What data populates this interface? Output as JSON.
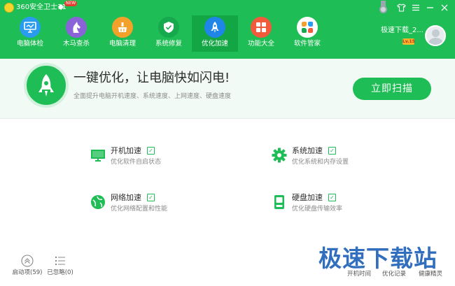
{
  "app": {
    "name": "360安全卫士11",
    "badge": "NEW"
  },
  "nav": [
    {
      "label": "电脑体检",
      "icon": "monitor-check-icon"
    },
    {
      "label": "木马查杀",
      "icon": "horse-icon"
    },
    {
      "label": "电脑清理",
      "icon": "broom-icon"
    },
    {
      "label": "系统修复",
      "icon": "shield-icon"
    },
    {
      "label": "优化加速",
      "icon": "rocket-icon",
      "active": true
    },
    {
      "label": "功能大全",
      "icon": "grid-icon"
    },
    {
      "label": "软件管家",
      "icon": "software-flower-icon"
    }
  ],
  "user": {
    "name": "极速下载_2...",
    "level": "Lv.15"
  },
  "banner": {
    "headline": "一键优化，让电脑快如闪电!",
    "subline": "全面提升电脑开机速度、系统速度、上网速度、硬盘速度",
    "scan_button": "立即扫描"
  },
  "features": [
    {
      "title": "开机加速",
      "desc": "优化软件自启状态",
      "checked": true
    },
    {
      "title": "系统加速",
      "desc": "优化系统和内存设置",
      "checked": true
    },
    {
      "title": "网络加速",
      "desc": "优化网络配置和性能",
      "checked": true
    },
    {
      "title": "硬盘加速",
      "desc": "优化硬盘传输效率",
      "checked": true
    }
  ],
  "bottom": {
    "startup": "启动项(59)",
    "ignored": "已忽略(0)",
    "boot_time": "开机时间",
    "history": "优化记录",
    "health": "健康精灵"
  },
  "watermark": "极速下载站",
  "colors": {
    "brand": "#1fbd55",
    "active_tab": "#13a645"
  }
}
